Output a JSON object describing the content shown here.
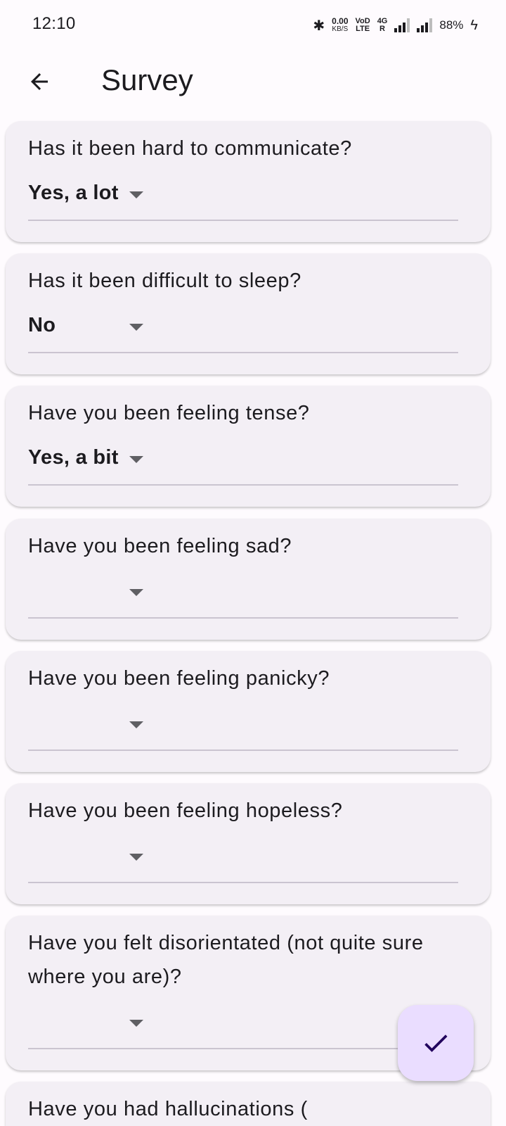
{
  "status_bar": {
    "time": "12:10",
    "net_speed_value": "0.00",
    "net_speed_unit": "KB/S",
    "volte_top": "VoD",
    "volte_bottom": "LTE",
    "network_type": "4G",
    "roaming": "R",
    "battery": "88%"
  },
  "app_bar": {
    "title": "Survey",
    "back_icon": "arrow-back-icon"
  },
  "questions": [
    {
      "text": "Has it been hard to communicate?",
      "answer": "Yes, a lot"
    },
    {
      "text": "Has it been difficult to sleep?",
      "answer": "No"
    },
    {
      "text": "Have you been feeling tense?",
      "answer": "Yes, a bit"
    },
    {
      "text": "Have you been feeling sad?",
      "answer": ""
    },
    {
      "text": "Have you been feeling panicky?",
      "answer": ""
    },
    {
      "text": "Have you been feeling hopeless?",
      "answer": ""
    },
    {
      "text": "Have you felt disorientated (not quite sure where you are)?",
      "answer": ""
    },
    {
      "text": "Have you had hallucinations (",
      "answer": ""
    }
  ],
  "fab": {
    "icon": "check-icon",
    "background": "#eaddff",
    "icon_color": "#21005d"
  },
  "colors": {
    "page_background": "#fefbfe",
    "card_background": "#f3eff5",
    "text": "#1c1b1f",
    "underline": "#cac4d0"
  }
}
